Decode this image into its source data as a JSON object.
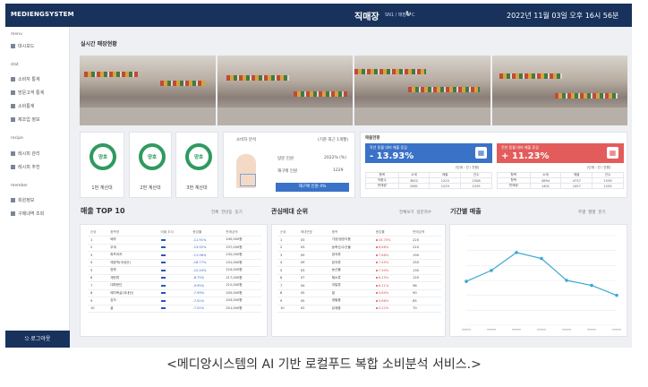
{
  "app": {
    "logo": "MEDIENGSYSTEM",
    "store": "직매장",
    "store_sub": "SN1 / 매장# C",
    "clock": "2022년 11월 03일 오후 16시 56분"
  },
  "sidebar": {
    "sec1": "menu",
    "item_dashboard": "대시보드",
    "sec2": "stat",
    "item_sales": "소비자 통계",
    "item_visit": "방문고객 통계",
    "item_analysis": "소비통계",
    "item_equip": "제조업 정보",
    "sec3": "recipe",
    "item_order": "레시피 관리",
    "item_menu": "레시피 추천",
    "sec4": "member",
    "item_member": "회원정보",
    "item_admin": "구매내역 조회",
    "logout": "로그아웃"
  },
  "main": {
    "cctv_title": "실시간 매장현황",
    "status": [
      {
        "ring": "양호",
        "label": "1번 계산대"
      },
      {
        "ring": "양호",
        "label": "2번 계산대"
      },
      {
        "ring": "양호",
        "label": "3번 계산대"
      }
    ],
    "stock": {
      "title": "소비자 분석",
      "period": "(기준 최근 1개월)",
      "row1_label": "방문 인원",
      "row1_value": "2022% (%)",
      "row2_label": "재구매 인원",
      "row2_value": "1229",
      "button": "재구매 인원 4%"
    },
    "sales_title": "매출현황",
    "blue": {
      "title": "작년 동월 대비 매출 증감",
      "value": "- 13.93%"
    },
    "red": {
      "title": "전년 동월 대비 매출 증감",
      "value": "+ 11.23%"
    },
    "unit": "(단위 : 건 / 천원)",
    "mini_head": [
      "항목",
      "소계",
      "매출",
      "건수"
    ],
    "mini_blue": [
      [
        "작품수",
        "3822",
        "1225",
        "2308"
      ],
      [
        "판매량",
        "2461",
        "1229",
        "1295"
      ]
    ],
    "mini_red": [
      [
        "항목",
        "4894",
        "4737",
        "1539"
      ],
      [
        "판매량",
        "1401",
        "1057",
        "1205"
      ]
    ],
    "top10": {
      "title": "매출 TOP 10",
      "tabs": [
        "전체",
        "전년동",
        "동기"
      ],
      "head": [
        "순위",
        "품목명",
        "비율 추이",
        "증감률",
        "판매금액"
      ],
      "rows": [
        [
          "1",
          "배추",
          "-11.91%",
          "245,000원"
        ],
        [
          "2",
          "무세",
          "-13.92%",
          "237,000원"
        ],
        [
          "3",
          "파프리카",
          "-11.96%",
          "232,000원"
        ],
        [
          "4",
          "애호박(국내산)",
          "-16.77%",
          "231,000원"
        ],
        [
          "5",
          "양파",
          "-12.20%",
          "224,000원"
        ],
        [
          "6",
          "계란류",
          "-8.75%",
          "217,000원"
        ],
        [
          "7",
          "대파한단",
          "-9.95%",
          "212,000원"
        ],
        [
          "8",
          "돼지목살(국내산)",
          "-7.99%",
          "205,000원"
        ],
        [
          "9",
          "감자",
          "-7.51%",
          "203,000원"
        ],
        [
          "10",
          "쌀",
          "-7.01%",
          "201,000원"
        ]
      ]
    },
    "interest": {
      "title": "관심매대 순위",
      "tabs": [
        "전체보기",
        "방문자수"
      ],
      "head": [
        "순위",
        "매대번호",
        "품목",
        "증감률",
        "판매금액"
      ],
      "rows": [
        [
          "1",
          "03",
          "가공/냉장식품",
          "33.75%",
          "220"
        ],
        [
          "2",
          "03",
          "농축산/수산물",
          "8.86%",
          "210"
        ],
        [
          "3",
          "09",
          "잡곡류",
          "7.88%",
          "190"
        ],
        [
          "4",
          "09",
          "잡곡류",
          "7.45%",
          "150"
        ],
        [
          "5",
          "03",
          "농산물",
          "7.30%",
          "130"
        ],
        [
          "6",
          "07",
          "채소류",
          "6.25%",
          "120"
        ],
        [
          "7",
          "04",
          "과일류",
          "6.11%",
          "98"
        ],
        [
          "8",
          "05",
          "쌀",
          "5.89%",
          "90"
        ],
        [
          "9",
          "05",
          "생필품",
          "5.66%",
          "85"
        ],
        [
          "10",
          "02",
          "유제품",
          "5.22%",
          "70"
        ]
      ]
    },
    "timeline": {
      "title": "기간별 매출",
      "tabs": [
        "주별",
        "월별",
        "분기"
      ]
    }
  },
  "chart_data": {
    "type": "line",
    "title": "기간별 매출",
    "x": [
      "1",
      "2",
      "3",
      "4",
      "5",
      "6",
      "7"
    ],
    "series": [
      {
        "values": [
          44,
          55,
          73,
          67,
          45,
          40,
          30
        ]
      }
    ],
    "ylim": [
      0,
      90
    ],
    "grid": true,
    "color": "#3aa8d0"
  },
  "caption": "<메디앙시스템의 AI 기반 로컬푸드 복합 소비분석 서비스.>"
}
